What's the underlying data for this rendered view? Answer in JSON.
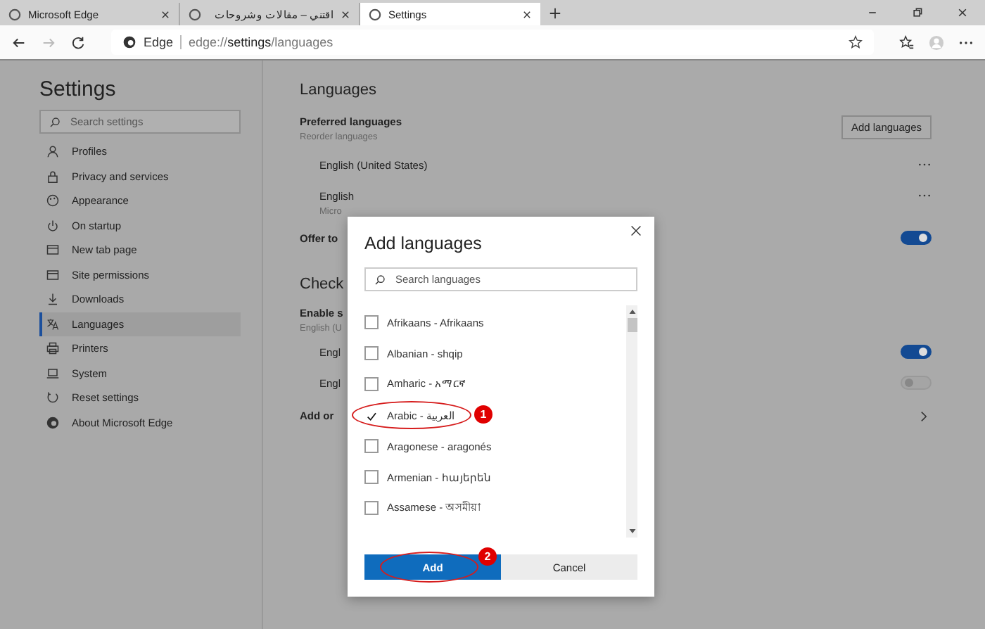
{
  "tabs": [
    {
      "title": "Microsoft Edge",
      "selected": false
    },
    {
      "title": "اقتني – مقالات وشروحات",
      "selected": false
    },
    {
      "title": "Settings",
      "selected": true
    }
  ],
  "address_bar": {
    "site_label": "Edge",
    "url": "edge://**settings**/languages"
  },
  "sidebar": {
    "title": "Settings",
    "search": {
      "placeholder": "Search settings"
    },
    "items": [
      {
        "label": "Profiles",
        "selected": false
      },
      {
        "label": "Privacy and services",
        "selected": false
      },
      {
        "label": "Appearance",
        "selected": false
      },
      {
        "label": "On startup",
        "selected": false
      },
      {
        "label": "New tab page",
        "selected": false
      },
      {
        "label": "Site permissions",
        "selected": false
      },
      {
        "label": "Downloads",
        "selected": false
      },
      {
        "label": "Languages",
        "selected": true
      },
      {
        "label": "Printers",
        "selected": false
      },
      {
        "label": "System",
        "selected": false
      },
      {
        "label": "Reset settings",
        "selected": false
      },
      {
        "label": "About Microsoft Edge",
        "selected": false
      }
    ]
  },
  "content": {
    "title": "Languages",
    "preferred_heading": "Preferred languages",
    "preferred_subheading": "Reorder languages",
    "add_button": "Add languages",
    "preferred_languages": [
      {
        "name": "English (United States)"
      },
      {
        "name": "English",
        "note": "Micro"
      }
    ],
    "offer_translate": {
      "label": "Offer to",
      "on": true
    },
    "spellcheck": {
      "title": "Check",
      "enable_label": "Enable s",
      "enable_note": "English (U",
      "languages": [
        {
          "name": "Engl",
          "on": true
        },
        {
          "name": "Engl",
          "on": false
        }
      ],
      "add_label": "Add or"
    }
  },
  "dialog": {
    "title": "Add languages",
    "search": {
      "placeholder": "Search languages"
    },
    "languages": [
      {
        "label": "Afrikaans - Afrikaans",
        "checked": false
      },
      {
        "label": "Albanian - shqip",
        "checked": false
      },
      {
        "label": "Amharic - አማርኛ",
        "checked": false
      },
      {
        "label": "Arabic - العربية",
        "checked": true,
        "callout": "1"
      },
      {
        "label": "Aragonese - aragonés",
        "checked": false
      },
      {
        "label": "Armenian - հայերեն",
        "checked": false
      },
      {
        "label": "Assamese - অসমীয়া",
        "checked": false
      }
    ],
    "buttons": [
      {
        "label": "Add",
        "kind": "primary",
        "callout": "2"
      },
      {
        "label": "Cancel",
        "kind": "secondary"
      }
    ]
  }
}
